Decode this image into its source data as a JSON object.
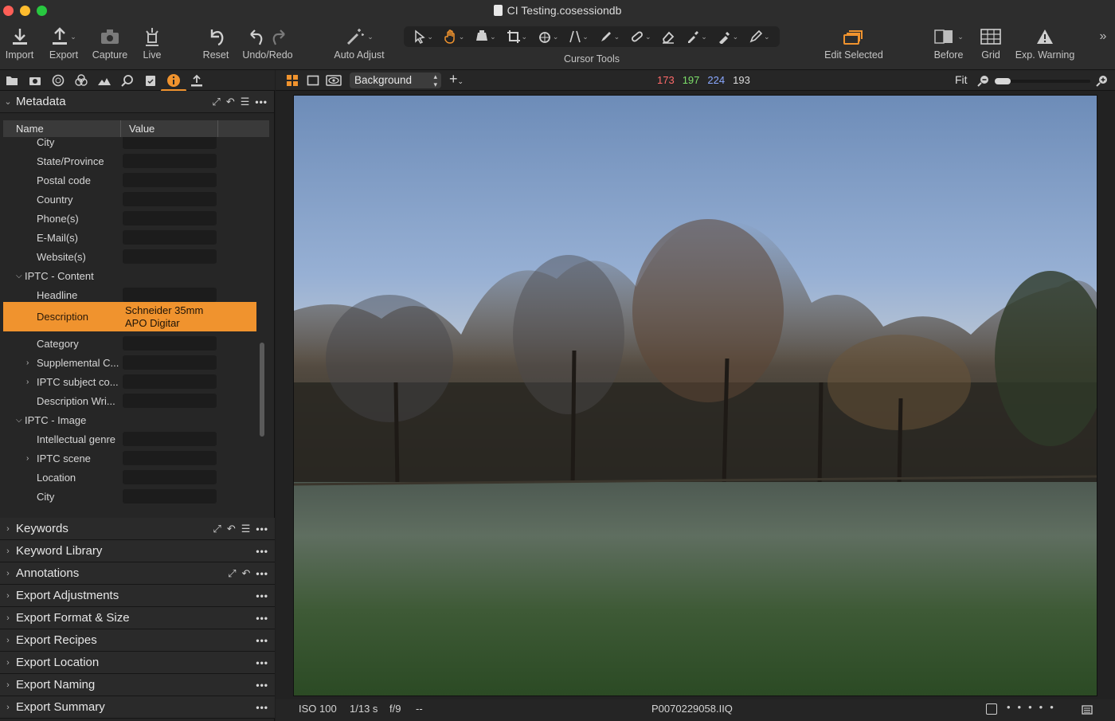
{
  "window": {
    "title": "CI Testing.cosessiondb"
  },
  "toolbar": {
    "import": "Import",
    "export": "Export",
    "capture": "Capture",
    "live": "Live",
    "reset": "Reset",
    "undo_redo": "Undo/Redo",
    "auto_adjust": "Auto Adjust",
    "cursor_tools": "Cursor Tools",
    "edit_selected": "Edit Selected",
    "before": "Before",
    "grid": "Grid",
    "exp_warning": "Exp. Warning",
    "accent": "#f0932e"
  },
  "viewer_bar": {
    "background": "Background",
    "rgb": {
      "r": "173",
      "g": "197",
      "b": "224",
      "l": "193"
    },
    "zoom": "Fit"
  },
  "metadata": {
    "title": "Metadata",
    "columns": {
      "name": "Name",
      "value": "Value"
    },
    "rows": [
      {
        "name": "City"
      },
      {
        "name": "State/Province"
      },
      {
        "name": "Postal code"
      },
      {
        "name": "Country"
      },
      {
        "name": "Phone(s)"
      },
      {
        "name": "E-Mail(s)"
      },
      {
        "name": "Website(s)"
      },
      {
        "name": "IPTC - Content"
      },
      {
        "name": "Headline"
      },
      {
        "name": "Description",
        "value_line1": "Schneider 35mm",
        "value_line2": "APO Digitar"
      },
      {
        "name": "Category"
      },
      {
        "name": "Supplemental C..."
      },
      {
        "name": "IPTC subject co..."
      },
      {
        "name": "Description Wri..."
      },
      {
        "name": "IPTC - Image"
      },
      {
        "name": "Intellectual genre"
      },
      {
        "name": "IPTC scene"
      },
      {
        "name": "Location"
      },
      {
        "name": "City"
      }
    ]
  },
  "sections": [
    {
      "title": "Keywords"
    },
    {
      "title": "Keyword Library"
    },
    {
      "title": "Annotations"
    },
    {
      "title": "Export Adjustments"
    },
    {
      "title": "Export Format & Size"
    },
    {
      "title": "Export Recipes"
    },
    {
      "title": "Export Location"
    },
    {
      "title": "Export Naming"
    },
    {
      "title": "Export Summary"
    }
  ],
  "status": {
    "iso": "ISO 100",
    "shutter": "1/13 s",
    "aperture": "f/9",
    "extra": "--",
    "filename": "P0070229058.IIQ"
  }
}
